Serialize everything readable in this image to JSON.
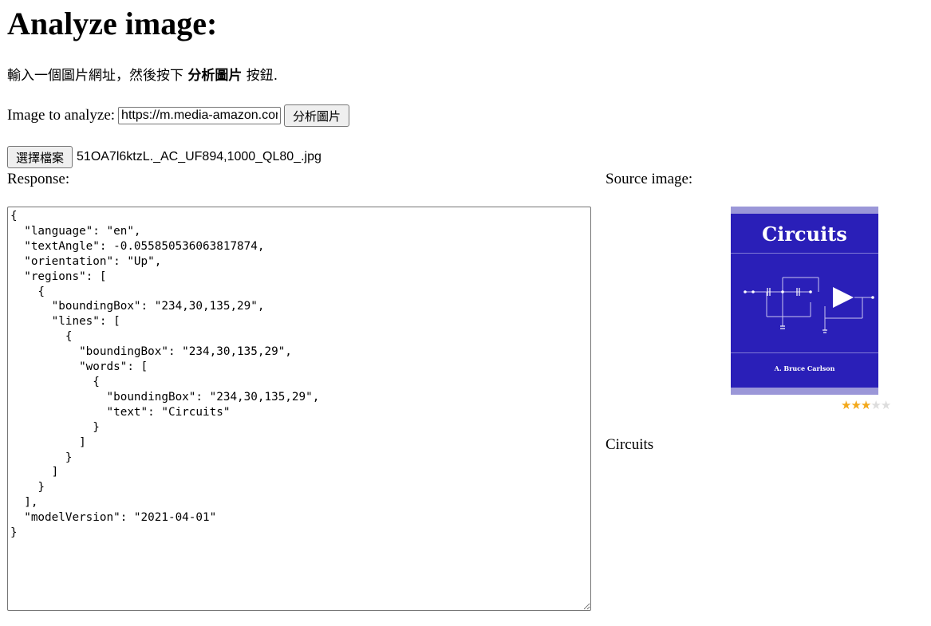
{
  "page": {
    "title": "Analyze image:",
    "instruction_prefix": "輸入一個圖片網址，然後按下 ",
    "instruction_bold": "分析圖片",
    "instruction_suffix": " 按鈕."
  },
  "form": {
    "url_label": "Image to analyze:",
    "url_value": "https://m.media-amazon.com",
    "analyze_button": "分析圖片",
    "file_button": "選擇檔案",
    "file_name": "51OA7l6ktzL._AC_UF894,1000_QL80_.jpg"
  },
  "response": {
    "label": "Response:",
    "json_text": "{\n  \"language\": \"en\",\n  \"textAngle\": -0.055850536063817874,\n  \"orientation\": \"Up\",\n  \"regions\": [\n    {\n      \"boundingBox\": \"234,30,135,29\",\n      \"lines\": [\n        {\n          \"boundingBox\": \"234,30,135,29\",\n          \"words\": [\n            {\n              \"boundingBox\": \"234,30,135,29\",\n              \"text\": \"Circuits\"\n            }\n          ]\n        }\n      ]\n    }\n  ],\n  \"modelVersion\": \"2021-04-01\"\n}"
  },
  "source": {
    "label": "Source image:",
    "cover_title": "Circuits",
    "cover_author": "A. Bruce Carlson",
    "rating": 3,
    "rating_max": 5,
    "caption": "Circuits"
  },
  "colors": {
    "cover_blue": "#2a1fb8",
    "star_on": "#f3a81b",
    "star_off": "#dddddd"
  }
}
